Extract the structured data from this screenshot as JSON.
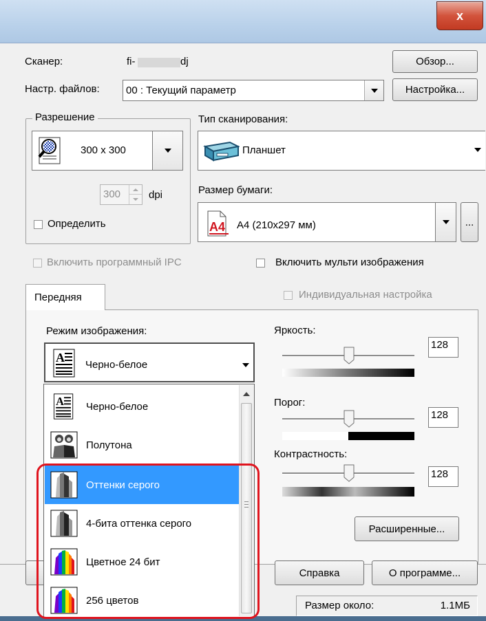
{
  "window": {
    "close_label": "x"
  },
  "scanner": {
    "label": "Сканер:",
    "model_prefix": "fi-",
    "model_suffix": "dj",
    "browse_button": "Обзор..."
  },
  "config": {
    "label": "Настр. файлов:",
    "value": "00 : Текущий параметр",
    "setup_button": "Настройка..."
  },
  "resolution": {
    "legend": "Разрешение",
    "value": "300 x 300",
    "dpi_value": "300",
    "dpi_unit": "dpi",
    "detect_label": "Определить"
  },
  "scan_type": {
    "label": "Тип сканирования:",
    "value": "Планшет"
  },
  "paper_size": {
    "label": "Размер бумаги:",
    "value": "A4 (210x297 мм)",
    "more_button": "...",
    "icon_text": "A4"
  },
  "options": {
    "ipc_label": "Включить программный IPC",
    "multi_label": "Включить мульти изображения"
  },
  "tabs": {
    "front": "Передняя",
    "individual_label": "Индивидуальная настройка"
  },
  "image_mode": {
    "label": "Режим изображения:",
    "value": "Черно-белое"
  },
  "brightness": {
    "label": "Яркость:",
    "value": "128",
    "level": 0.5
  },
  "threshold": {
    "label": "Порог:",
    "value": "128",
    "level": 0.5
  },
  "contrast": {
    "label": "Контрастность:",
    "value": "128",
    "level": 0.5
  },
  "advanced_button": "Расширенные...",
  "dropdown": {
    "items": [
      {
        "label": "Черно-белое",
        "icon": "bw-document-icon",
        "selected": false
      },
      {
        "label": "Полутона",
        "icon": "halftone-people-icon",
        "selected": false
      },
      {
        "label": "Оттенки серого",
        "icon": "grayscale-icon",
        "selected": true
      },
      {
        "label": "4-бита оттенка серого",
        "icon": "grayscale-4bit-icon",
        "selected": false
      },
      {
        "label": "Цветное 24 бит",
        "icon": "color-24bit-icon",
        "selected": false
      },
      {
        "label": "256 цветов",
        "icon": "color-256-icon",
        "selected": false
      }
    ]
  },
  "bottom": {
    "help_button": "Справка",
    "about_button": "О программе...",
    "size_label": "Размер около:",
    "size_value": "1.1МБ"
  },
  "colors": {
    "selection": "#3399ff",
    "highlight_outline": "#e0141e",
    "close_button": "#c9452e"
  }
}
